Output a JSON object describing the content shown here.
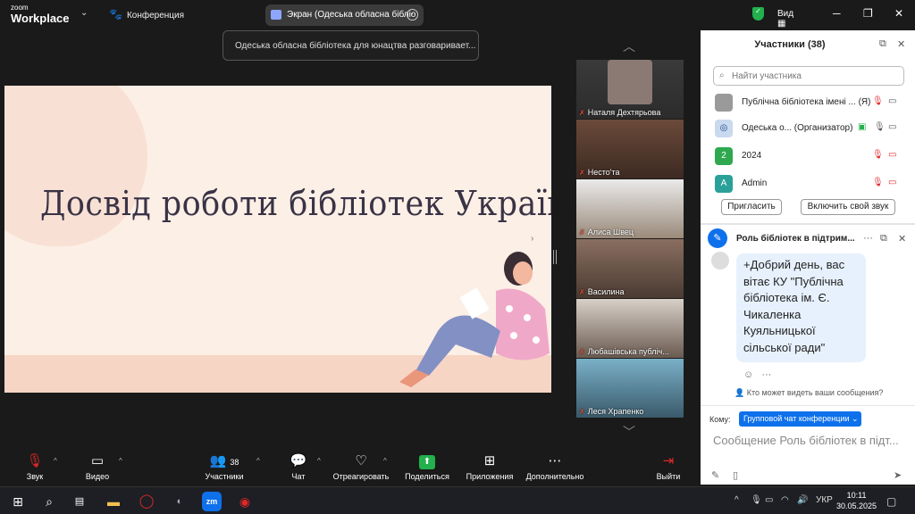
{
  "titlebar": {
    "logo_top": "zoom",
    "logo_bottom": "Workplace",
    "meeting_label": "Конференция",
    "screen_share_label": "Экран (Одеська обласна бібліо",
    "view_label": "Вид"
  },
  "notification": "Одеська обласна бібліотека для юнацтва разговаривает...",
  "slide": {
    "title": "Досвід роботи бібліотек України"
  },
  "participants_strip": [
    {
      "name": "Наталя Дехтярьова"
    },
    {
      "name": "Несто'та"
    },
    {
      "name": "Алиса Швец"
    },
    {
      "name": "Василина"
    },
    {
      "name": "Любашівська публіч..."
    },
    {
      "name": "Леся Храпенко"
    }
  ],
  "participants_panel": {
    "title": "Участники (38)",
    "search_placeholder": "Найти участника",
    "rows": [
      {
        "name": "Публічна бібліотека імені ...",
        "tag": "(Я)"
      },
      {
        "name": "Одеська о...",
        "tag": "(Организатор)"
      },
      {
        "name": "2024",
        "avatar": "2"
      },
      {
        "name": "Admin",
        "avatar": "A"
      }
    ],
    "invite_button": "Пригласить",
    "unmute_button": "Включить свой звук"
  },
  "chat": {
    "title": "Роль бібліотек в підтрим...",
    "message": "+Добрий день, вас вітає КУ \"Публічна бібліотека ім. Є. Чикаленка Куяльницької сільської ради\"",
    "visibility_text": "Кто может видеть ваши сообщения?",
    "to_label": "Кому:",
    "to_value": "Групповой чат конференции ⌄",
    "input_placeholder": "Сообщение Роль бібліотек в підт..."
  },
  "toolbar": {
    "audio": "Звук",
    "video": "Видео",
    "participants": "Участники",
    "participants_count": "38",
    "chat": "Чат",
    "react": "Отреагировать",
    "share": "Поделиться",
    "apps": "Приложения",
    "more": "Дополнительно",
    "leave": "Выйти"
  },
  "taskbar": {
    "lang": "УКР",
    "time": "10:11",
    "date": "30.05.2025",
    "zoom_app": "zm"
  },
  "colors": {
    "accent": "#0e71eb",
    "share_green": "#22b14c",
    "leave_red": "#e02828"
  }
}
